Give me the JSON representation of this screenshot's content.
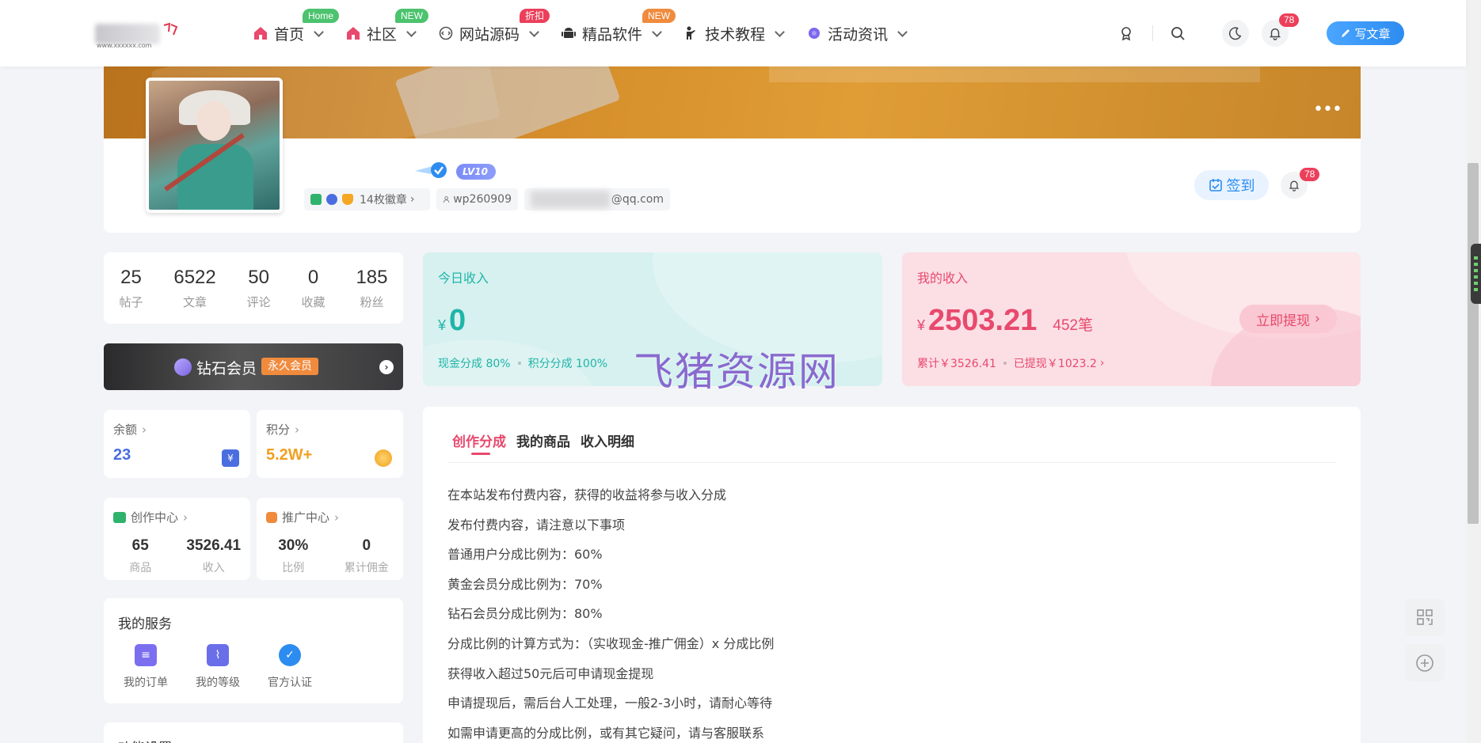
{
  "header": {
    "logo_small_text": "www.xxxxxx.com",
    "nav": [
      {
        "label": "首页",
        "badge": "Home",
        "badge_color": "#4cc36e",
        "icon_color": "#e8496d"
      },
      {
        "label": "社区",
        "badge": "NEW",
        "badge_color": "#4cc36e",
        "icon_color": "#e8496d"
      },
      {
        "label": "网站源码",
        "badge": "折扣",
        "badge_color": "#ec3f5a",
        "icon_color": "#555"
      },
      {
        "label": "精品软件",
        "badge": "NEW",
        "badge_color": "#f08b3e",
        "icon_color": "#333"
      },
      {
        "label": "技术教程",
        "badge": "",
        "badge_color": "",
        "icon_color": "#333"
      },
      {
        "label": "活动资讯",
        "badge": "",
        "badge_color": "",
        "icon_color": "#7b68ee"
      }
    ],
    "notif_count": "78",
    "write_label": "写文章"
  },
  "profile": {
    "level": "LV10",
    "badges_label": "14枚徽章",
    "username": "wp260909",
    "email_suffix": "@qq.com",
    "signin_label": "签到",
    "notif_count": "78"
  },
  "stats": [
    {
      "num": "25",
      "label": "帖子"
    },
    {
      "num": "6522",
      "label": "文章"
    },
    {
      "num": "50",
      "label": "评论"
    },
    {
      "num": "0",
      "label": "收藏"
    },
    {
      "num": "185",
      "label": "粉丝"
    }
  ],
  "vip": {
    "name": "钻石会员",
    "tag": "永久会员"
  },
  "balance": {
    "title": "余额",
    "value": "23",
    "color": "#4a6ee0"
  },
  "points": {
    "title": "积分",
    "value": "5.2W+",
    "color": "#f0a020"
  },
  "creation": {
    "title": "创作中心",
    "v1": "65",
    "l1": "商品",
    "v2": "3526.41",
    "l2": "收入"
  },
  "promo": {
    "title": "推广中心",
    "v1": "30%",
    "l1": "比例",
    "v2": "0",
    "l2": "累计佣金"
  },
  "services": {
    "title": "我的服务",
    "items": [
      {
        "label": "我的订单",
        "color": "#7b6ff0"
      },
      {
        "label": "我的等级",
        "color": "#6a6ee8"
      },
      {
        "label": "官方认证",
        "color": "#2d8cf0"
      }
    ]
  },
  "func_settings": "功能设置",
  "today_income": {
    "label": "今日收入",
    "currency": "¥",
    "amount": "0",
    "cash_share": "现金分成 80%",
    "point_share": "积分分成 100%",
    "color": "#1fb5a8"
  },
  "my_income": {
    "label": "我的收入",
    "currency": "¥",
    "amount": "2503.21",
    "count": "452笔",
    "total": "累计￥3526.41",
    "withdrawn": "已提现￥1023.2",
    "withdraw_btn": "立即提现",
    "color": "#e8496d"
  },
  "watermark": "飞猪资源网",
  "tabs": [
    "创作分成",
    "我的商品",
    "收入明细"
  ],
  "rules": [
    "在本站发布付费内容，获得的收益将参与收入分成",
    "发布付费内容，请注意以下事项",
    "普通用户分成比例为：60%",
    "黄金会员分成比例为：70%",
    "钻石会员分成比例为：80%",
    "分成比例的计算方式为：（实收现金-推广佣金）x 分成比例",
    "获得收入超过50元后可申请现金提现",
    "申请提现后，需后台人工处理，一般2-3小时，请耐心等待",
    "如需申请更高的分成比例，或有其它疑问，请与客服联系"
  ]
}
